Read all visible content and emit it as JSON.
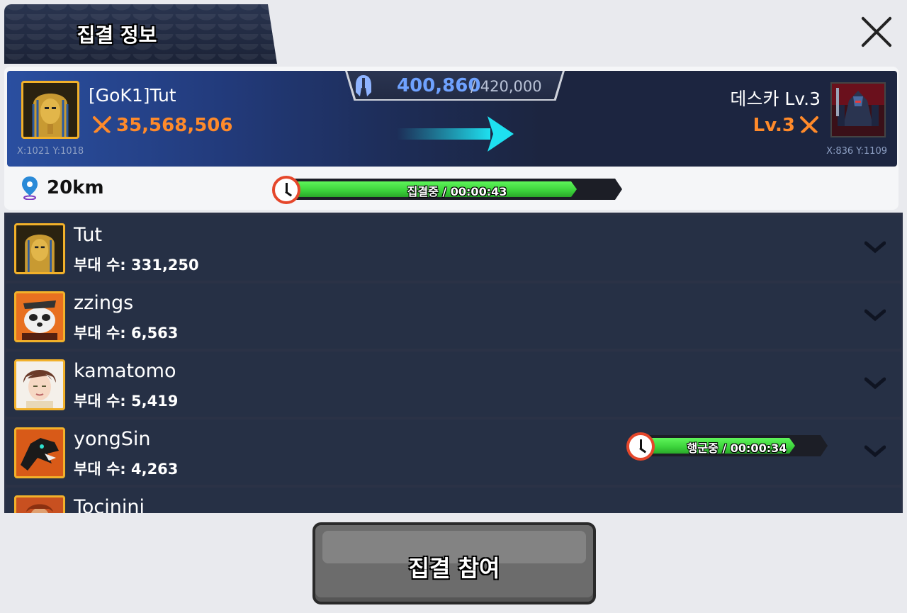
{
  "header": {
    "title": "집결 정보"
  },
  "rally": {
    "troops_current": "400,860",
    "troops_max": "/ 420,000",
    "leader": {
      "name": "[GoK1]Tut",
      "power": "35,568,506",
      "coord": "X:1021 Y:1018",
      "avatar_icon": "pharaoh-mask-icon"
    },
    "target": {
      "name": "데스카 Lv.3",
      "level": "Lv.3",
      "coord": "X:836 Y:1109",
      "avatar_icon": "dark-knight-icon"
    },
    "distance": "20km",
    "timer": {
      "label": "집결중 / 00:00:43",
      "progress": 0.88
    }
  },
  "members": [
    {
      "name": "Tut",
      "troops": "부대 수: 331,250",
      "avatar_icon": "pharaoh-mask-icon"
    },
    {
      "name": "zzings",
      "troops": "부대 수: 6,563",
      "avatar_icon": "panda-warrior-icon"
    },
    {
      "name": "kamatomo",
      "troops": "부대 수: 5,419",
      "avatar_icon": "anime-boy-icon"
    },
    {
      "name": "yongSin",
      "troops": "부대 수: 4,263",
      "avatar_icon": "black-dragon-icon",
      "march": {
        "label": "행군중 / 00:00:34",
        "progress": 0.85
      }
    },
    {
      "name": "Tocinini",
      "troops": "",
      "avatar_icon": "warrior-icon"
    }
  ],
  "footer": {
    "join_label": "집결 참여"
  },
  "colors": {
    "power": "#ff8a2a",
    "troops_current": "#6fa2ff",
    "timer_green": "#3bd23a",
    "panel_dark": "#263045"
  }
}
